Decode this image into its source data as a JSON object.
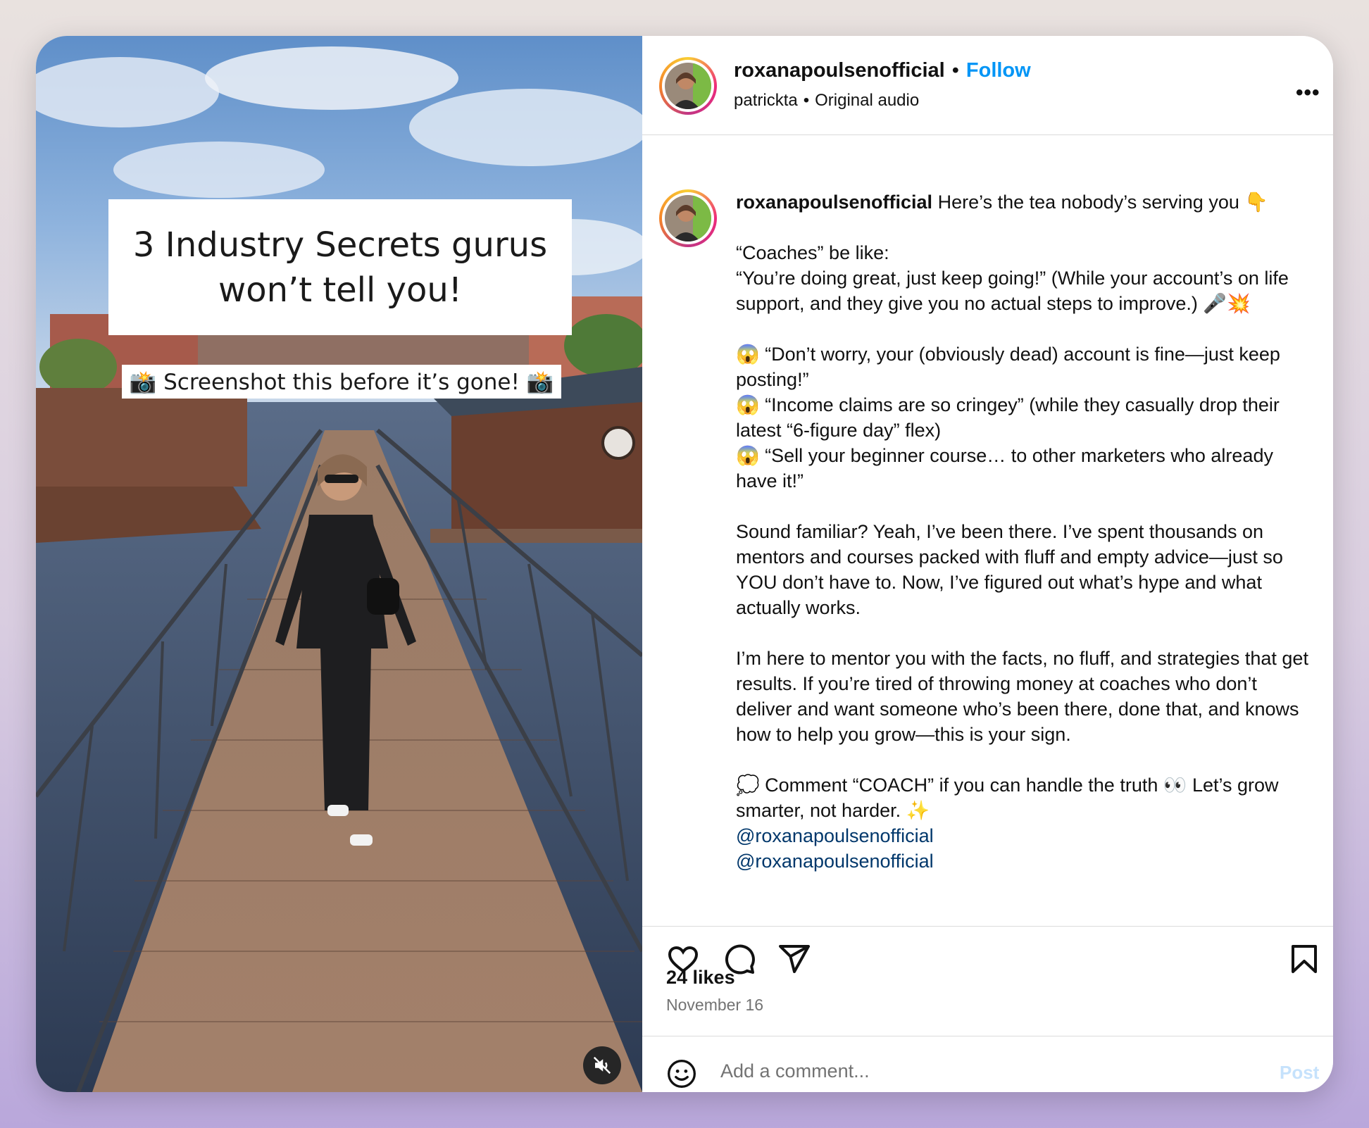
{
  "post": {
    "author": "roxanapoulsenofficial",
    "follow_label": "Follow",
    "separator": "•",
    "audio_user": "patrickta",
    "audio_label": "Original audio",
    "more_label": "•••"
  },
  "media": {
    "overlay_title": "3 Industry Secrets gurus won’t tell you!",
    "overlay_subtitle": "📸 Screenshot this before it’s gone! 📸"
  },
  "caption": {
    "username": "roxanapoulsenofficial",
    "body": "Here’s the tea nobody’s serving you 👇\n\n“Coaches” be like:\n“You’re doing great, just keep going!” (While your account’s on life support, and they give you no actual steps to improve.) 🎤💥\n\n😱 “Don’t worry, your (obviously dead) account is fine—just keep posting!”\n😱 “Income claims are so cringey” (while they casually drop their latest “6-figure day” flex)\n😱 “Sell your beginner course… to other marketers who already have it!”\n\nSound familiar? Yeah, I’ve been there. I’ve spent thousands on mentors and courses packed with fluff and empty advice—just so YOU don’t have to. Now, I’ve figured out what’s hype and what actually works.\n\nI’m here to mentor you with the facts, no fluff, and strategies that get results. If you’re tired of throwing money at coaches who don’t deliver and want someone who’s been there, done that, and knows how to help you grow—this is your sign.\n\n💭 Comment “COACH” if you can handle the truth 👀 Let’s grow smarter, not harder. ✨\n",
    "mentions": [
      "@roxanapoulsenofficial",
      "@roxanapoulsenofficial"
    ]
  },
  "stats": {
    "likes": "24 likes",
    "date": "November 16"
  },
  "comment_box": {
    "placeholder": "Add a comment...",
    "post_label": "Post"
  },
  "icons": [
    "heart-icon",
    "comment-icon",
    "share-icon",
    "bookmark-icon",
    "emoji-icon",
    "mute-icon",
    "more-icon"
  ],
  "colors": {
    "follow": "#0095f6",
    "mention": "#00376b",
    "post_disabled": "#c6e2fc",
    "muted_text": "#737373"
  }
}
